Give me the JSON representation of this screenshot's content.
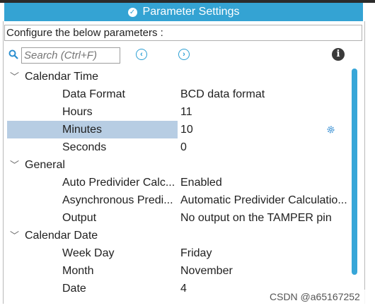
{
  "header": {
    "title": "Parameter Settings",
    "icon": "check-circle-icon"
  },
  "configure_label": "Configure the below parameters :",
  "search": {
    "placeholder": "Search (Ctrl+F)",
    "value": ""
  },
  "toolbar": {
    "prev_icon": "chevron-left-circle-icon",
    "next_icon": "chevron-right-circle-icon",
    "info_icon": "info-icon"
  },
  "groups": [
    {
      "label": "Calendar Time",
      "params": [
        {
          "name": "Data Format",
          "value": "BCD data format"
        },
        {
          "name": "Hours",
          "value": "11"
        },
        {
          "name": "Minutes",
          "value": "10"
        },
        {
          "name": "Seconds",
          "value": "0"
        }
      ]
    },
    {
      "label": "General",
      "params": [
        {
          "name": "Auto Predivider Calc...",
          "value": "Enabled"
        },
        {
          "name": "Asynchronous Predi...",
          "value": "Automatic Predivider Calculatio..."
        },
        {
          "name": "Output",
          "value": "No output on the TAMPER pin"
        }
      ]
    },
    {
      "label": "Calendar Date",
      "params": [
        {
          "name": "Week Day",
          "value": "Friday"
        },
        {
          "name": "Month",
          "value": "November"
        },
        {
          "name": "Date",
          "value": "4"
        }
      ]
    }
  ],
  "selected_param": "Minutes",
  "watermark": "CSDN @a65167252",
  "colors": {
    "accent": "#34a3d3",
    "selection": "#b7cde3",
    "scrollbar": "#37a6d8"
  }
}
